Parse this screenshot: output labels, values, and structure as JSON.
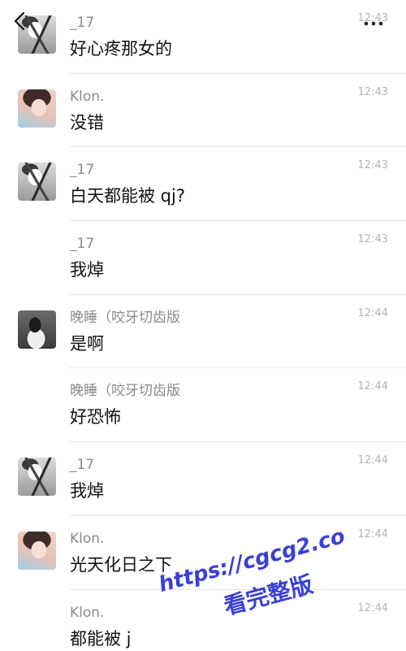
{
  "nav": {
    "back_icon": "chevron-left-icon",
    "more_icon": "more-dots-icon"
  },
  "messages": [
    {
      "sender": "_17",
      "time": "12:43",
      "text": "好心疼那女的",
      "avatar": "avatar-17"
    },
    {
      "sender": "Klon.",
      "time": "12:43",
      "text": "没错",
      "avatar": "avatar-klon"
    },
    {
      "sender": "_17",
      "time": "12:43",
      "text": "白天都能被 qj?",
      "avatar": "avatar-17"
    },
    {
      "sender": "_17",
      "time": "12:43",
      "text": "我焯",
      "avatar": null
    },
    {
      "sender": "晚睡（咬牙切齿版",
      "time": "12:44",
      "text": "是啊",
      "avatar": "avatar-wanshui"
    },
    {
      "sender": "晚睡（咬牙切齿版",
      "time": "12:44",
      "text": "好恐怖",
      "avatar": null
    },
    {
      "sender": "_17",
      "time": "12:44",
      "text": "我焯",
      "avatar": "avatar-17"
    },
    {
      "sender": "Klon.",
      "time": "12:44",
      "text": "光天化日之下",
      "avatar": "avatar-klon"
    },
    {
      "sender": "Klon.",
      "time": "12:44",
      "text": "都能被 j",
      "avatar": null
    }
  ],
  "watermark": {
    "url": "https://cgcg2.co",
    "caption": "看完整版",
    "color": "#3a3fd8"
  }
}
